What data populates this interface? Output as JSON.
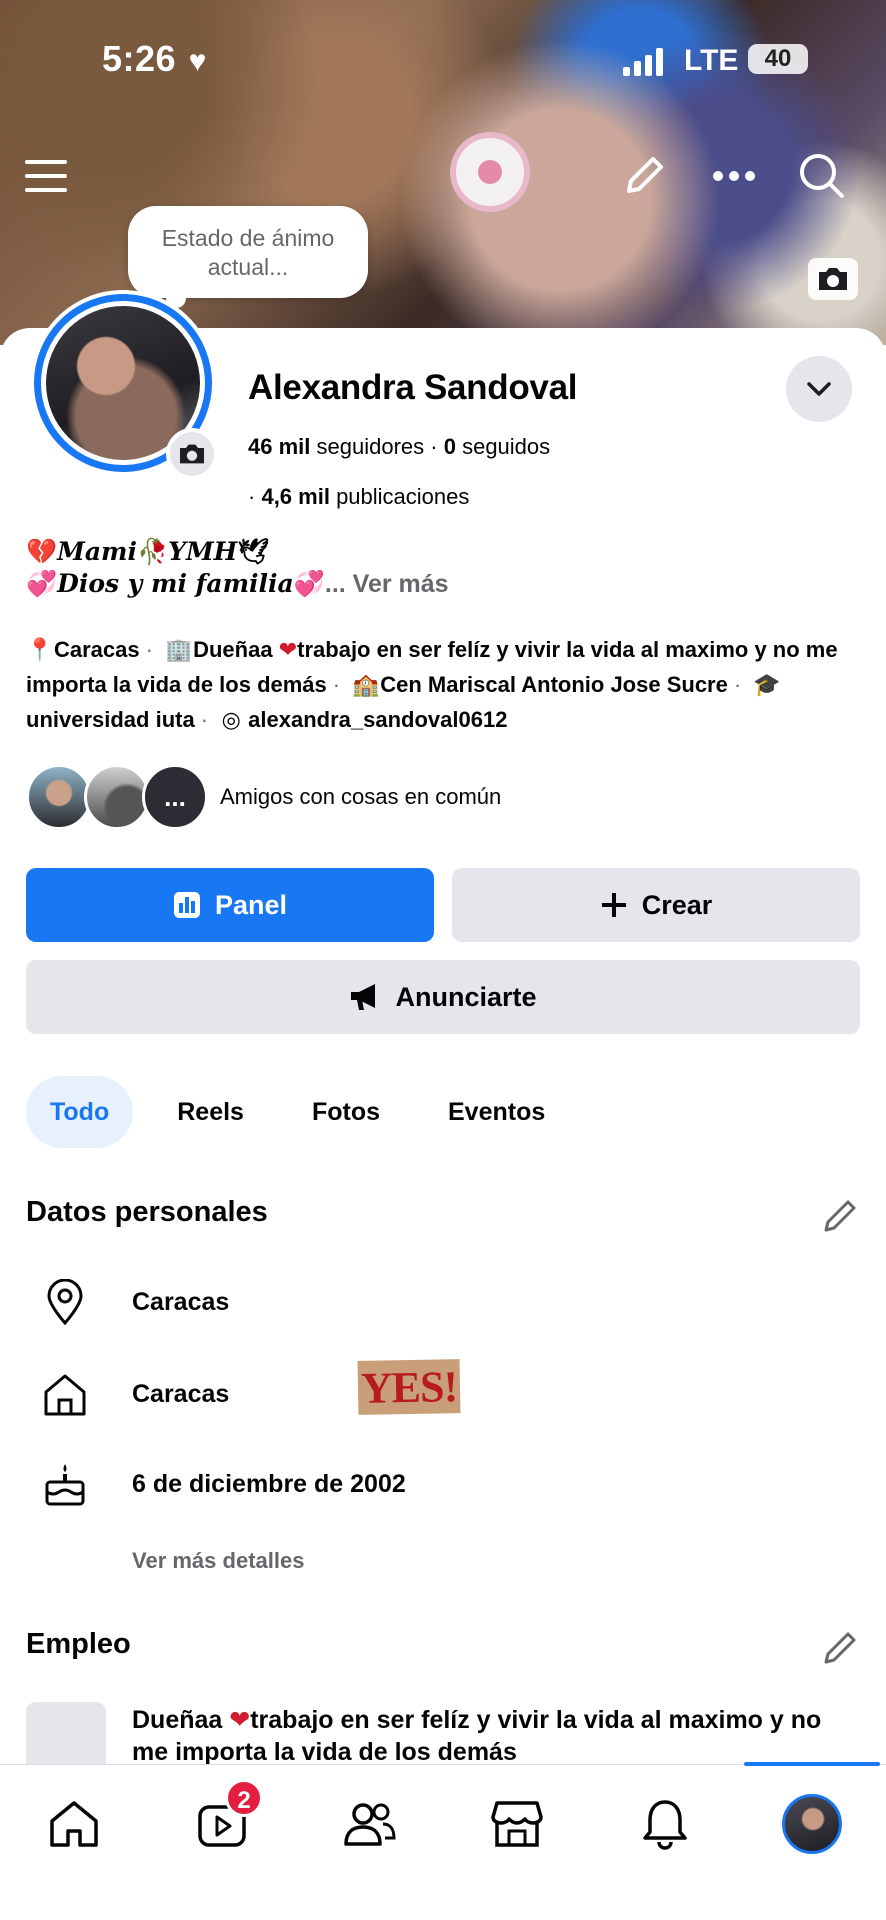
{
  "status_bar": {
    "time": "5:26",
    "network": "LTE",
    "battery": "40"
  },
  "cover": {
    "mood_prompt": "Estado de ánimo actual..."
  },
  "profile": {
    "name": "Alexandra Sandoval",
    "followers_count": "46 mil",
    "followers_label": "seguidores",
    "following_count": "0",
    "following_label": "seguidos",
    "posts_count": "4,6 mil",
    "posts_label": "publicaciones"
  },
  "bio": {
    "line1": "Mami",
    "line1_b": "YMH",
    "line2": "Dios y mi familia",
    "more": "... Ver más"
  },
  "intro": {
    "location": "Caracas",
    "work": "Dueñaa",
    "work_rest": "trabajo en ser felíz y vivir la vida al maximo y no me importa la vida de los demás",
    "school": "Cen Mariscal Antonio Jose Sucre",
    "university": "universidad iuta",
    "instagram": "alexandra_sandoval0612"
  },
  "mutual": {
    "label": "Amigos con cosas en común",
    "more": "..."
  },
  "buttons": {
    "panel": "Panel",
    "crear": "Crear",
    "anunciarte": "Anunciarte"
  },
  "tabs": [
    "Todo",
    "Reels",
    "Fotos",
    "Eventos"
  ],
  "personal": {
    "title": "Datos personales",
    "city": "Caracas",
    "hometown": "Caracas",
    "birthday": "6 de diciembre de 2002",
    "more_details": "Ver más detalles",
    "sticker": "YES!"
  },
  "employment": {
    "title": "Empleo",
    "text_a": "Dueñaa",
    "text_b": "trabajo en ser felíz y vivir la vida al maximo y no me importa la vida de los demás"
  },
  "nav": {
    "reels_badge": "2"
  },
  "colors": {
    "accent": "#1877f2",
    "badge": "#e41e3f",
    "button_gray": "#e4e6eb"
  }
}
